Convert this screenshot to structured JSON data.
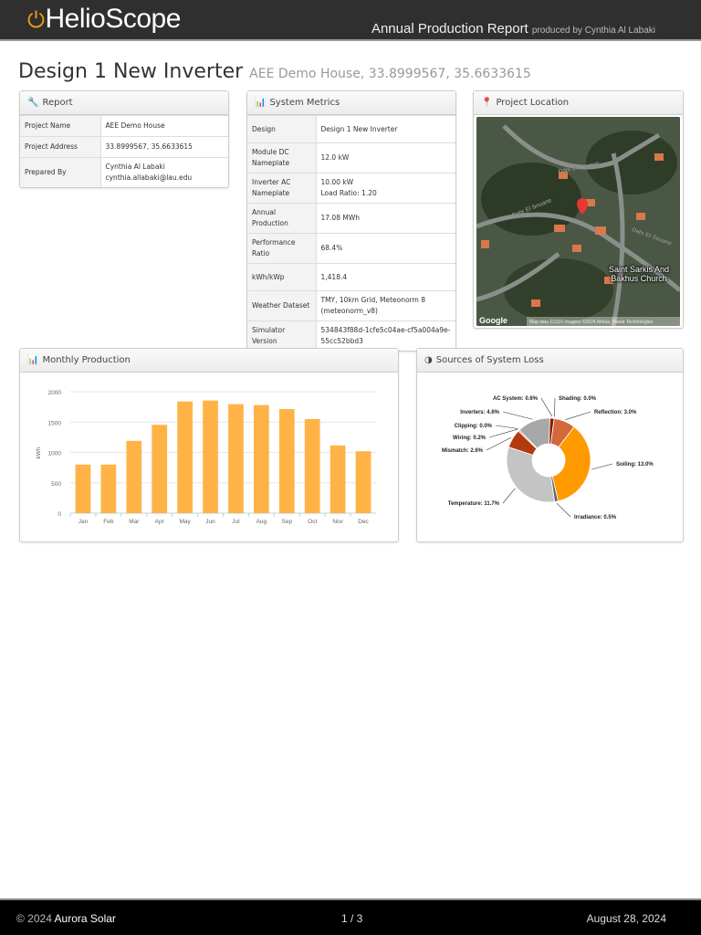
{
  "header": {
    "logo": "HelioScope",
    "report_title": "Annual Production Report",
    "produced_by": "produced by Cynthia Al Labaki"
  },
  "page": {
    "title": "Design 1 New Inverter",
    "subtitle": "AEE Demo House, 33.8999567, 35.6633615"
  },
  "report": {
    "heading": "Report",
    "rows": [
      {
        "k": "Project Name",
        "v": "AEE Demo House"
      },
      {
        "k": "Project Address",
        "v": "33.8999567, 35.6633615"
      },
      {
        "k": "Prepared By",
        "v": "Cynthia Al Labaki",
        "v2": "cynthia.allabaki@lau.edu"
      }
    ]
  },
  "metrics": {
    "heading": "System Metrics",
    "rows": [
      {
        "k": "Design",
        "v": "Design 1 New Inverter"
      },
      {
        "k": "Module DC Nameplate",
        "v": "12.0 kW"
      },
      {
        "k": "Inverter AC Nameplate",
        "v": "10.00 kW",
        "v2": "Load Ratio: 1.20"
      },
      {
        "k": "Annual Production",
        "v": "17.08 MWh"
      },
      {
        "k": "Performance Ratio",
        "v": "68.4%"
      },
      {
        "k": "kWh/kWp",
        "v": "1,418.4"
      },
      {
        "k": "Weather Dataset",
        "v": "TMY, 10km Grid, Meteonorm 8 (meteonorm_v8)"
      },
      {
        "k": "Simulator Version",
        "v": "534843f88d-1cfe5c04ae-cf5a004a9e-55cc52bbd3"
      }
    ]
  },
  "location": {
    "heading": "Project Location",
    "map_labels": [
      "Dahr El Souane",
      "Dahr El Souane",
      "Dahr El Souane",
      "Saint Sarkis And Bakhus Church"
    ],
    "google": "Google",
    "attribution": "Map data ©2024 Imagery ©2024 Airbus, Maxar Technologies"
  },
  "monthly": {
    "heading": "Monthly Production"
  },
  "losses": {
    "heading": "Sources of System Loss"
  },
  "chart_data": [
    {
      "type": "bar",
      "title": "Monthly Production",
      "ylabel": "kWh",
      "ylim": [
        0,
        2000
      ],
      "yticks": [
        0,
        500,
        1000,
        1500,
        2000
      ],
      "categories": [
        "Jan",
        "Feb",
        "Mar",
        "Apr",
        "May",
        "Jun",
        "Jul",
        "Aug",
        "Sep",
        "Oct",
        "Nov",
        "Dec"
      ],
      "values": [
        800,
        800,
        1190,
        1455,
        1840,
        1855,
        1795,
        1780,
        1715,
        1550,
        1115,
        1020
      ],
      "color": "#ffb347"
    },
    {
      "type": "pie",
      "title": "Sources of System Loss",
      "slices": [
        {
          "label": "AC System: 0.6%",
          "value": 0.6,
          "color": "#8b1a00"
        },
        {
          "label": "Shading: 0.0%",
          "value": 0.0,
          "color": "#e07b39"
        },
        {
          "label": "Reflection: 3.0%",
          "value": 3.0,
          "color": "#d2693a"
        },
        {
          "label": "Soiling: 13.0%",
          "value": 13.0,
          "color": "#ff9900"
        },
        {
          "label": "Irradiance: 0.5%",
          "value": 0.5,
          "color": "#666666"
        },
        {
          "label": "Temperature: 11.7%",
          "value": 11.7,
          "color": "#c4c4c4"
        },
        {
          "label": "Mismatch: 2.6%",
          "value": 2.6,
          "color": "#b33a0c"
        },
        {
          "label": "Wiring: 0.2%",
          "value": 0.2,
          "color": "#d07a55"
        },
        {
          "label": "Clipping: 0.0%",
          "value": 0.0,
          "color": "#999999"
        },
        {
          "label": "Inverters: 4.6%",
          "value": 4.6,
          "color": "#a8a8a8"
        }
      ]
    }
  ],
  "footer": {
    "copyright": "© 2024",
    "company": "Aurora Solar",
    "page": "1 / 3",
    "date": "August 28, 2024"
  }
}
